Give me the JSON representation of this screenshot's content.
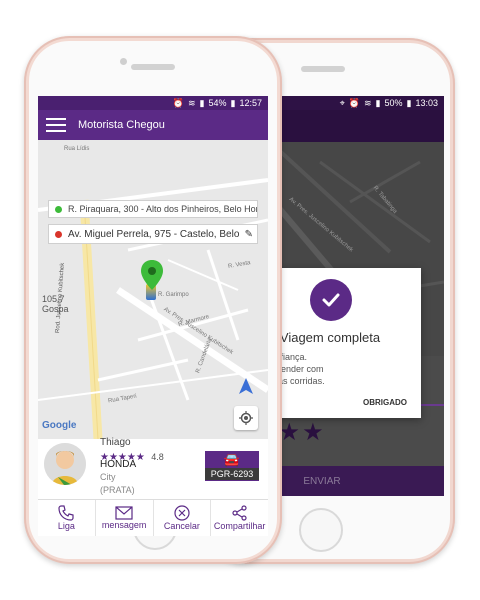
{
  "front": {
    "status": {
      "battery": "54%",
      "time": "12:57"
    },
    "appbar": {
      "title": "Motorista Chegou"
    },
    "origin_address": "R. Piraquara, 300 - Alto dos Pinheiros, Belo Horizo...",
    "destination_address": "Av. Miguel Perrela, 975 - Castelo, Belo ...",
    "map_labels": {
      "street1": "Rua Lídis",
      "street2": "Av. Pres. Juscelino Kubitschek",
      "street3": "Rod. Juscelino Kubitschek",
      "street4": "R. Garimpo",
      "street5": "R. Marmore",
      "street6": "R. Candelária",
      "street7": "R. Vesta",
      "street8": "Rua Taperi",
      "radio": "105.7",
      "radio_sub": "Gospa",
      "google": "Google"
    },
    "driver": {
      "name": "Thiago",
      "rating": "4.8",
      "car_make": "HONDA",
      "car_model": "City",
      "car_color": "(PRATA)",
      "plate": "PGR-6293"
    },
    "nav": {
      "call": "Liga",
      "message": "mensagem",
      "cancel": "Cancelar",
      "share": "Compartilhar"
    }
  },
  "back": {
    "status": {
      "battery": "50%",
      "time": "13:03"
    },
    "dialog": {
      "title": "Viagem completa",
      "line1": "radecemos sua confiança.",
      "line2": "amos sempre lhe atender com",
      "line3": "encia durante nossas corridas.",
      "button": "OBRIGADO"
    },
    "submit_button": "ENVIAR",
    "map_labels": {
      "street1": "R. Tabatinga",
      "street2": "Av. Pres. Juscelino Kubitschek"
    }
  },
  "colors": {
    "primary": "#5b2a86",
    "primary_dark": "#4a2070",
    "dim_overlay": "#3b1a55",
    "pin_green": "#3dbb3a",
    "star": "#5b2a86"
  }
}
